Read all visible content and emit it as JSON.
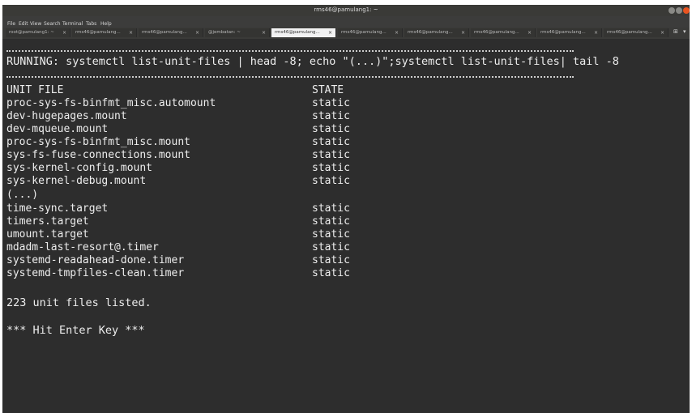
{
  "window": {
    "title": "rms46@pamulang1: ~"
  },
  "menu": [
    "File",
    "Edit",
    "View",
    "Search",
    "Terminal",
    "Tabs",
    "Help"
  ],
  "tabs": [
    "root@pamulang1: ~",
    "rms46@pamulang...",
    "rms46@pamulang...",
    "@jembatan: ~",
    "rms46@pamulang...",
    "rms46@pamulang...",
    "rms46@pamulang...",
    "rms46@pamulang...",
    "rms46@pamulang...",
    "rms46@pamulang..."
  ],
  "active_tab_index": 4,
  "terminal": {
    "running": "RUNNING: systemctl list-unit-files | head -8; echo \"(...)\";systemctl list-unit-files| tail -8",
    "header": {
      "unit": "UNIT FILE",
      "state": "STATE"
    },
    "rows": [
      {
        "unit": "proc-sys-fs-binfmt_misc.automount",
        "state": "static"
      },
      {
        "unit": "dev-hugepages.mount",
        "state": "static"
      },
      {
        "unit": "dev-mqueue.mount",
        "state": "static"
      },
      {
        "unit": "proc-sys-fs-binfmt_misc.mount",
        "state": "static"
      },
      {
        "unit": "sys-fs-fuse-connections.mount",
        "state": "static"
      },
      {
        "unit": "sys-kernel-config.mount",
        "state": "static"
      },
      {
        "unit": "sys-kernel-debug.mount",
        "state": "static"
      }
    ],
    "ellipsis": "(...)",
    "tail_rows": [
      {
        "unit": "time-sync.target",
        "state": "static"
      },
      {
        "unit": "timers.target",
        "state": "static"
      },
      {
        "unit": "umount.target",
        "state": "static"
      },
      {
        "unit": "mdadm-last-resort@.timer",
        "state": "static"
      },
      {
        "unit": "systemd-readahead-done.timer",
        "state": "static"
      },
      {
        "unit": "systemd-tmpfiles-clean.timer",
        "state": "static"
      }
    ],
    "summary": "223 unit files listed.",
    "prompt": "*** Hit Enter Key ***"
  },
  "colors": {
    "terminal_bg": "#2d2d2d",
    "text": "#ededed",
    "close_button": "#e95420"
  }
}
